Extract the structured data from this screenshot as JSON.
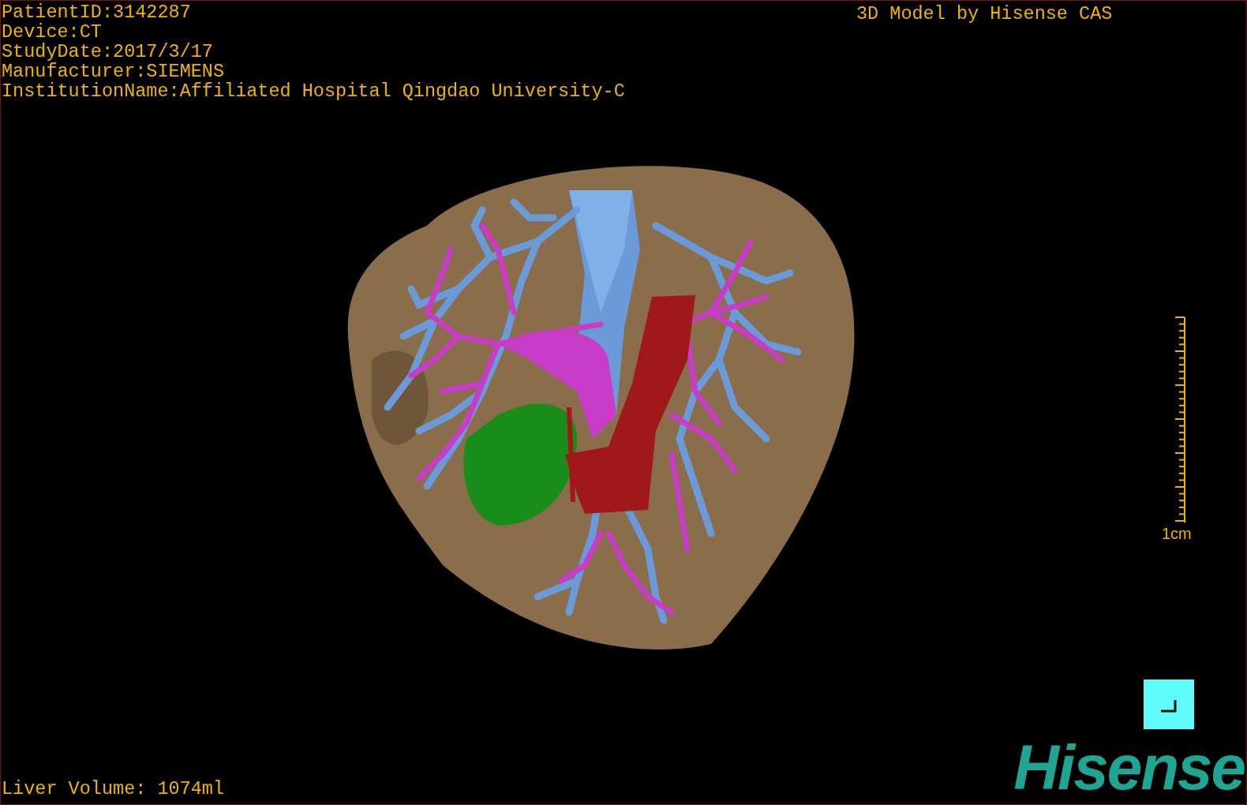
{
  "patient_info": [
    "PatientID:3142287",
    "Device:CT",
    "StudyDate:2017/3/17",
    "Manufacturer:SIEMENS",
    "InstitutionName:Affiliated Hospital Qingdao University-C"
  ],
  "model_label": "3D Model by Hisense CAS",
  "scale_bar": {
    "label": "1cm"
  },
  "liver_volume": "Liver Volume: 1074ml",
  "logo": "Hisense"
}
